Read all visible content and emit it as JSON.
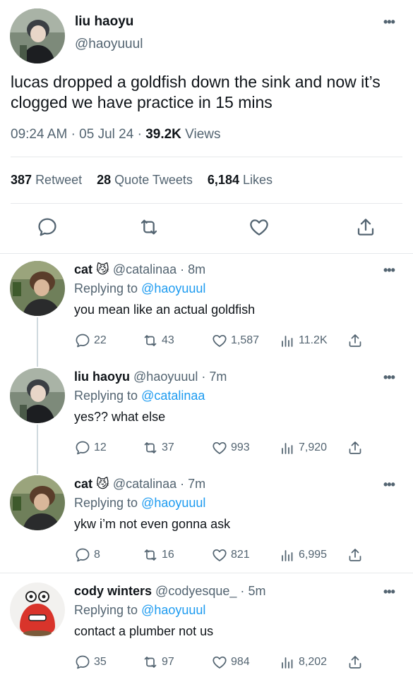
{
  "colors": {
    "text": "#0f1419",
    "muted": "#536471",
    "link": "#1d9bf0",
    "divider": "#e6e9eb"
  },
  "main_tweet": {
    "name": "liu haoyu",
    "handle": "@haoyuuul",
    "more": "•••",
    "text": "lucas dropped a goldfish down the sink and now it’s clogged we have practice in 15 mins",
    "time": "09:24 AM",
    "date": "05 Jul 24",
    "views_count": "39.2K",
    "views_label": "Views",
    "retweets_count": "387",
    "retweets_label": "Retweet",
    "quotes_count": "28",
    "quotes_label": "Quote Tweets",
    "likes_count": "6,184",
    "likes_label": "Likes",
    "action_icons": [
      "reply-icon",
      "retweet-icon",
      "like-icon",
      "share-icon"
    ]
  },
  "replies": [
    {
      "name": "cat",
      "emoji": "😼",
      "handle": "@catalinaa",
      "time": "8m",
      "replying_prefix": "Replying to",
      "replying_to": "@haoyuuul",
      "text": "you mean like an actual goldfish",
      "replies": "22",
      "retweets": "43",
      "likes": "1,587",
      "views": "11.2K"
    },
    {
      "name": "liu haoyu",
      "emoji": "",
      "handle": "@haoyuuul",
      "time": "7m",
      "replying_prefix": "Replying to",
      "replying_to": "@catalinaa",
      "text": "yes?? what else",
      "replies": "12",
      "retweets": "37",
      "likes": "993",
      "views": "7,920"
    },
    {
      "name": "cat",
      "emoji": "😼",
      "handle": "@catalinaa",
      "time": "7m",
      "replying_prefix": "Replying to",
      "replying_to": "@haoyuuul",
      "text": "ykw i’m not even gonna ask",
      "replies": "8",
      "retweets": "16",
      "likes": "821",
      "views": "6,995"
    },
    {
      "name": "cody winters",
      "emoji": "",
      "handle": "@codyesque_",
      "time": "5m",
      "replying_prefix": "Replying to",
      "replying_to": "@haoyuuul",
      "text": "contact a plumber not us",
      "replies": "35",
      "retweets": "97",
      "likes": "984",
      "views": "8,202"
    }
  ]
}
